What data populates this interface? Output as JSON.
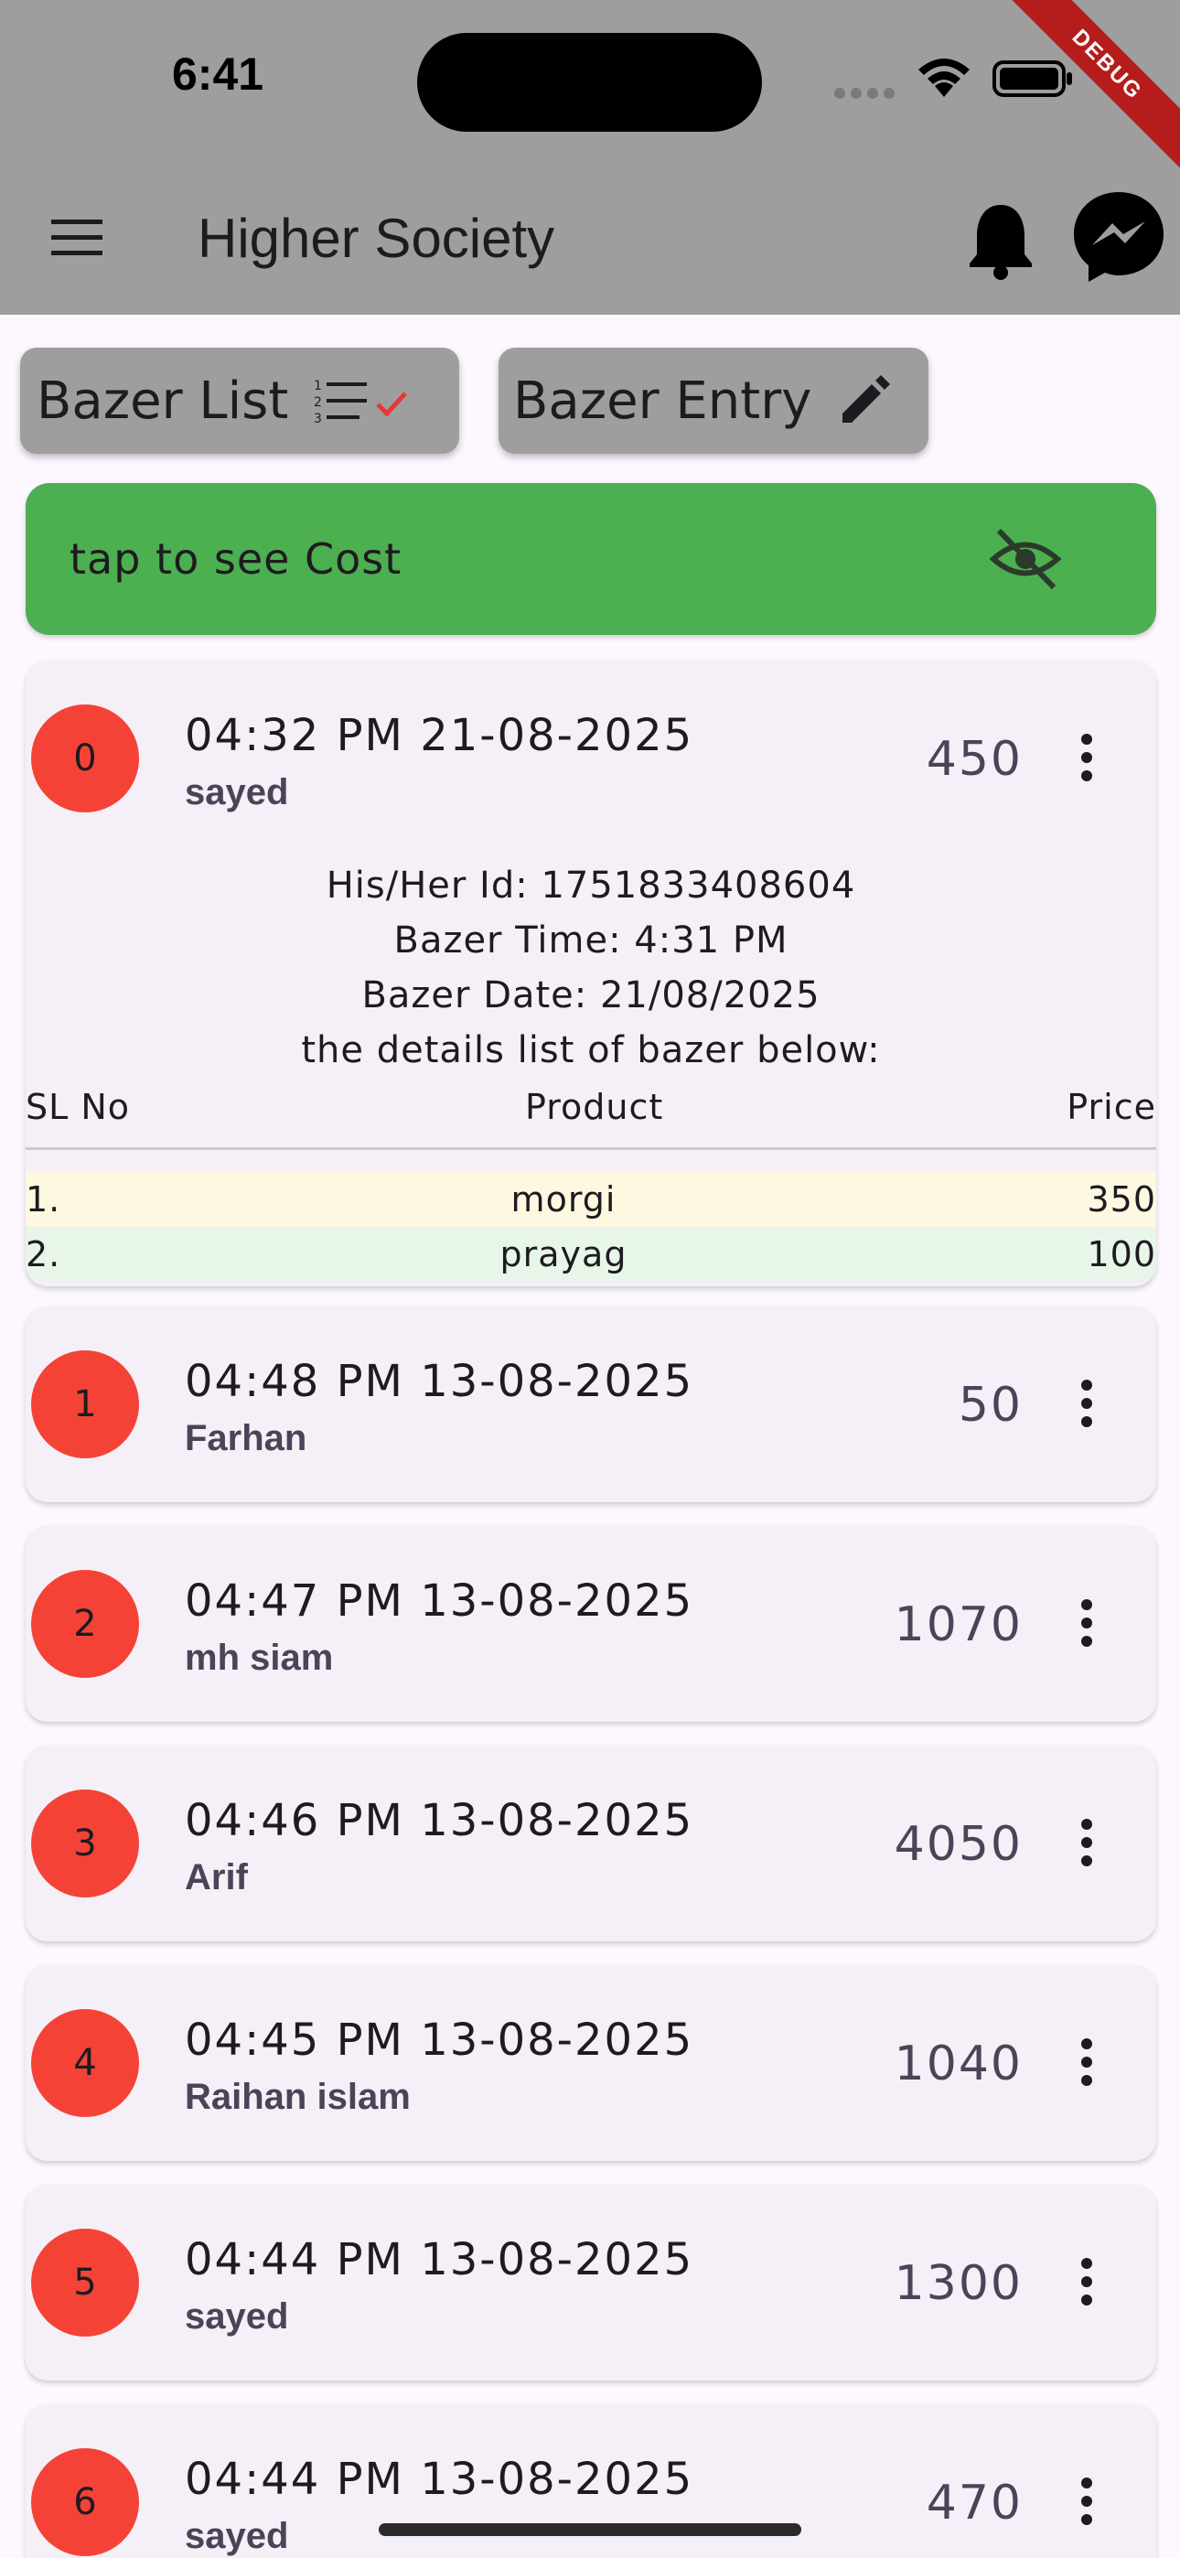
{
  "status_bar": {
    "time": "6:41",
    "debug_label": "DEBUG"
  },
  "app_bar": {
    "title": "Higher Society"
  },
  "tabs": [
    {
      "label": "Bazer List",
      "icon": "checklist-icon"
    },
    {
      "label": "Bazer Entry",
      "icon": "edit-icon"
    }
  ],
  "cost_banner": {
    "text": "tap to see Cost",
    "icon": "eye-off-icon"
  },
  "expanded": {
    "id_line": "His/Her Id: 1751833408604",
    "time_line": "Bazer Time: 4:31 PM",
    "date_line": "Bazer Date: 21/08/2025",
    "list_caption": "the details list of bazer below:",
    "columns": [
      "SL No",
      "Product",
      "Price"
    ],
    "rows": [
      {
        "sl": "1.",
        "product": "morgi",
        "price": "350"
      },
      {
        "sl": "2.",
        "product": "prayag",
        "price": "100"
      }
    ]
  },
  "entries": [
    {
      "index": "0",
      "datetime": "04:32 PM 21-08-2025",
      "name": "sayed",
      "amount": "450"
    },
    {
      "index": "1",
      "datetime": "04:48 PM 13-08-2025",
      "name": "Farhan",
      "amount": "50"
    },
    {
      "index": "2",
      "datetime": "04:47 PM 13-08-2025",
      "name": "mh siam",
      "amount": "1070"
    },
    {
      "index": "3",
      "datetime": "04:46 PM 13-08-2025",
      "name": "Arif",
      "amount": "4050"
    },
    {
      "index": "4",
      "datetime": "04:45 PM 13-08-2025",
      "name": "Raihan islam",
      "amount": "1040"
    },
    {
      "index": "5",
      "datetime": "04:44 PM 13-08-2025",
      "name": "sayed",
      "amount": "1300"
    },
    {
      "index": "6",
      "datetime": "04:44 PM 13-08-2025",
      "name": "sayed",
      "amount": "470"
    }
  ],
  "colors": {
    "app_bar": "#9e9e9e",
    "banner": "#4caf50",
    "avatar": "#f44336",
    "background": "#fdf7ff",
    "check_accent": "#e53935"
  }
}
